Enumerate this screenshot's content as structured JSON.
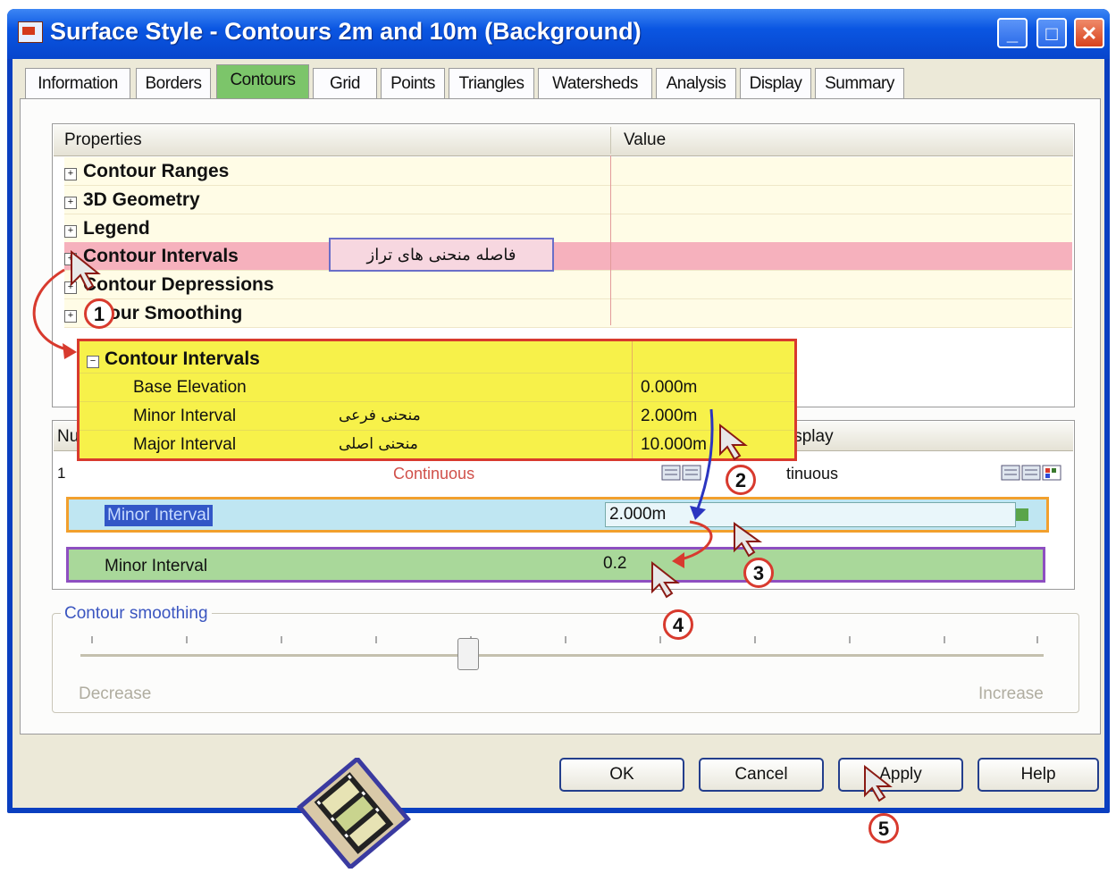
{
  "window": {
    "title": "Surface Style - Contours 2m and 10m (Background)",
    "min_glyph": "_",
    "max_glyph": "□",
    "close_glyph": "✕"
  },
  "tabs": [
    {
      "label": "Information"
    },
    {
      "label": "Borders"
    },
    {
      "label": "Contours",
      "active": true
    },
    {
      "label": "Grid"
    },
    {
      "label": "Points"
    },
    {
      "label": "Triangles"
    },
    {
      "label": "Watersheds"
    },
    {
      "label": "Analysis"
    },
    {
      "label": "Display"
    },
    {
      "label": "Summary"
    }
  ],
  "property_grid": {
    "header_properties": "Properties",
    "header_value": "Value",
    "rows": [
      {
        "label": "Contour Ranges"
      },
      {
        "label": "3D Geometry"
      },
      {
        "label": "Legend"
      },
      {
        "label": "Contour Intervals"
      },
      {
        "label": "Contour Depressions"
      },
      {
        "label": "tour Smoothing"
      }
    ],
    "highlight_note": "فاصله منحنی های تراز"
  },
  "expanded_intervals": {
    "title": "Contour Intervals",
    "rows": [
      {
        "label": "Base Elevation",
        "value": "0.000m",
        "note": ""
      },
      {
        "label": "Minor Interval",
        "value": "2.000m",
        "note": "منحنی فرعی"
      },
      {
        "label": "Major Interval",
        "value": "10.000m",
        "note": "منحنی اصلی"
      }
    ]
  },
  "display_list": {
    "header_num": "Nu",
    "header_display": "isplay",
    "row_num": "1",
    "row_linetype": "Continuous",
    "row_linetype2": "tinuous"
  },
  "edit_rows": [
    {
      "label": "Minor Interval",
      "value": "2.000m"
    },
    {
      "label": "Minor Interval",
      "value": "0.2"
    }
  ],
  "smoothing": {
    "label": "Contour smoothing",
    "left": "Decrease",
    "right": "Increase"
  },
  "buttons": {
    "ok": "OK",
    "cancel": "Cancel",
    "apply": "Apply",
    "help": "Help"
  },
  "steps": [
    "1",
    "2",
    "3",
    "4",
    "5"
  ],
  "colors": {
    "title_bar": "#0a56e2",
    "active_tab": "#7cc56a",
    "selected_row": "#f6b1bd",
    "popup_fill": "#f7f14a",
    "marker_red": "#d83a2e"
  }
}
